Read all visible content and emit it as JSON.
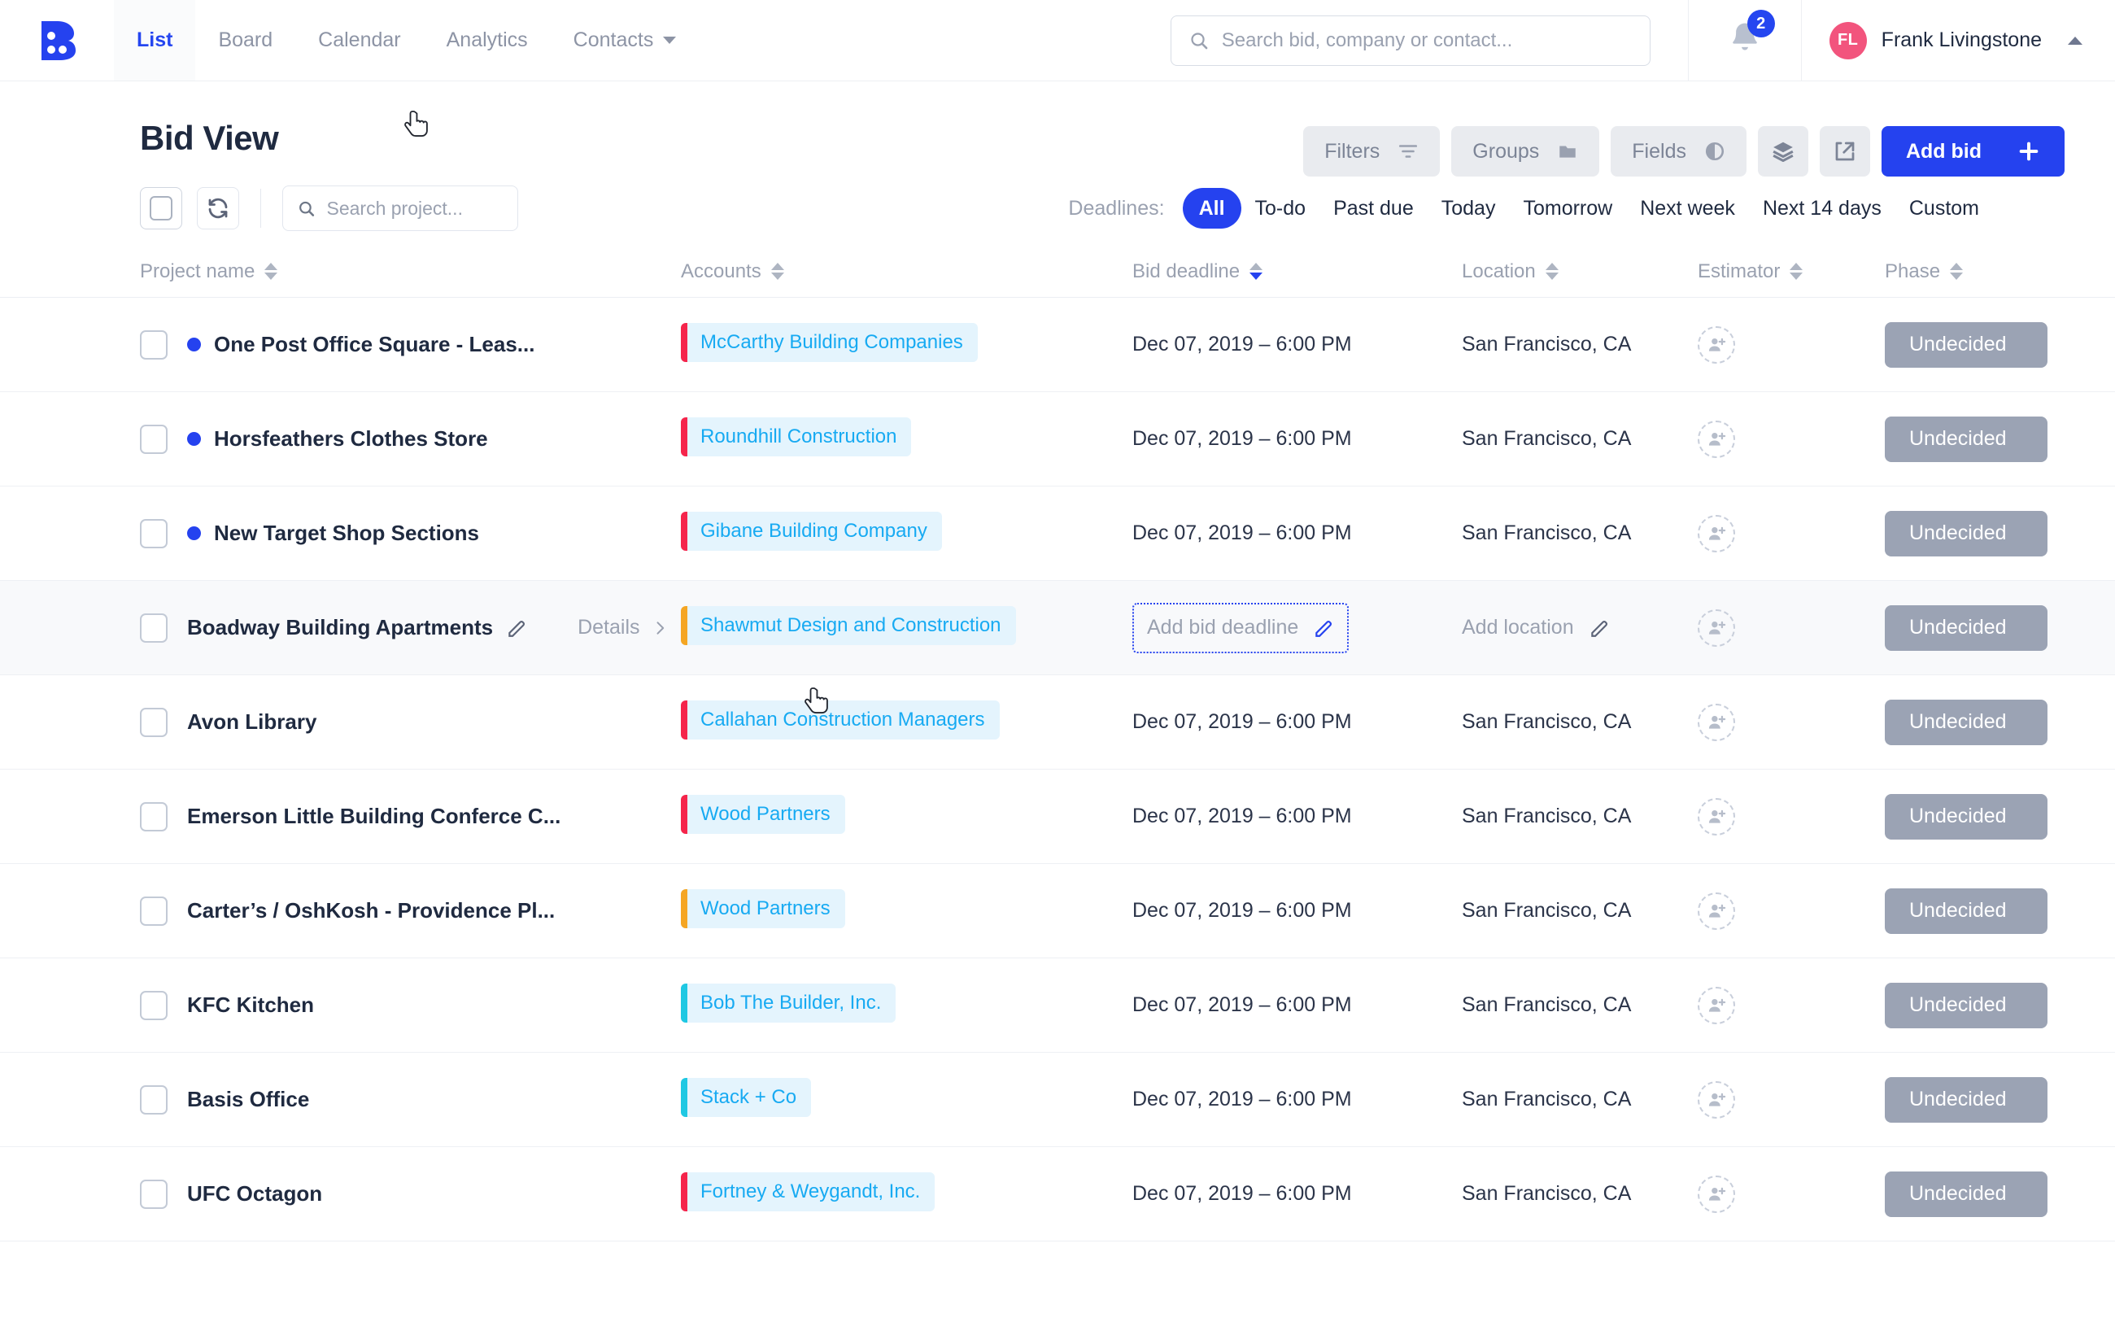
{
  "brand": {
    "accent": "#2542ef",
    "tag_text": "#17aaf2",
    "tag_bg": "#e4f4fd",
    "avatar_bg": "#f2547d",
    "phase_bg": "#9ba3b4"
  },
  "topnav": {
    "logo_name": "bid-logo",
    "tabs": [
      {
        "label": "List",
        "active": true
      },
      {
        "label": "Board",
        "active": false
      },
      {
        "label": "Calendar",
        "active": false
      },
      {
        "label": "Analytics",
        "active": false
      },
      {
        "label": "Contacts",
        "active": false,
        "caret": true
      }
    ],
    "search_placeholder": "Search bid, company or contact...",
    "search_value": "",
    "notification_count": "2",
    "user": {
      "initials": "FL",
      "name": "Frank Livingstone"
    }
  },
  "page": {
    "title": "Bid View"
  },
  "toolbar": {
    "filters_label": "Filters",
    "groups_label": "Groups",
    "fields_label": "Fields",
    "add_bid_label": "Add bid"
  },
  "subbar": {
    "project_search_placeholder": "Search project...",
    "project_search_value": ""
  },
  "deadlines": {
    "label": "Deadlines:",
    "options": [
      {
        "label": "All",
        "active": true
      },
      {
        "label": "To-do",
        "active": false
      },
      {
        "label": "Past due",
        "active": false
      },
      {
        "label": "Today",
        "active": false
      },
      {
        "label": "Tomorrow",
        "active": false
      },
      {
        "label": "Next week",
        "active": false
      },
      {
        "label": "Next 14 days",
        "active": false
      },
      {
        "label": "Custom",
        "active": false
      }
    ]
  },
  "table": {
    "columns": [
      {
        "label": "Project name",
        "sorted": false
      },
      {
        "label": "Accounts",
        "sorted": false
      },
      {
        "label": "Bid deadline",
        "sorted": true
      },
      {
        "label": "Location",
        "sorted": false
      },
      {
        "label": "Estimator",
        "sorted": false
      },
      {
        "label": "Phase",
        "sorted": false
      }
    ],
    "rows": [
      {
        "name": "One Post Office Square - Leas...",
        "unread": true,
        "highlight": false,
        "account": "McCarthy Building Companies",
        "account_color": "#f5254b",
        "deadline": "Dec 07, 2019 – 6:00 PM",
        "location": "San Francisco, CA",
        "phase": "Undecided"
      },
      {
        "name": "Horsfeathers Clothes Store",
        "unread": true,
        "highlight": false,
        "account": "Roundhill Construction",
        "account_color": "#f5254b",
        "deadline": "Dec 07, 2019 – 6:00 PM",
        "location": "San Francisco, CA",
        "phase": "Undecided"
      },
      {
        "name": "New Target Shop Sections",
        "unread": true,
        "highlight": false,
        "account": "Gibane Building Company",
        "account_color": "#f5254b",
        "deadline": "Dec 07, 2019 – 6:00 PM",
        "location": "San Francisco, CA",
        "phase": "Undecided"
      },
      {
        "name": "Boadway Building Apartments",
        "unread": false,
        "highlight": true,
        "details_label": "Details",
        "account": "Shawmut Design and Construction",
        "account_color": "#f5a623",
        "deadline": "",
        "deadline_placeholder": "Add bid deadline",
        "location": "",
        "location_placeholder": "Add location",
        "phase": "Undecided"
      },
      {
        "name": "Avon Library",
        "unread": false,
        "highlight": false,
        "account": "Callahan Construction Managers",
        "account_color": "#f5254b",
        "deadline": "Dec 07, 2019 – 6:00 PM",
        "location": "San Francisco, CA",
        "phase": "Undecided"
      },
      {
        "name": "Emerson Little Building Conferce C...",
        "unread": false,
        "highlight": false,
        "account": "Wood Partners",
        "account_color": "#f5254b",
        "deadline": "Dec 07, 2019 – 6:00 PM",
        "location": "San Francisco, CA",
        "phase": "Undecided"
      },
      {
        "name": "Carter’s / OshKosh - Providence Pl...",
        "unread": false,
        "highlight": false,
        "account": "Wood Partners",
        "account_color": "#f5a623",
        "deadline": "Dec 07, 2019 – 6:00 PM",
        "location": "San Francisco, CA",
        "phase": "Undecided"
      },
      {
        "name": "KFC Kitchen",
        "unread": false,
        "highlight": false,
        "account": "Bob The Builder, Inc.",
        "account_color": "#1fc8e3",
        "deadline": "Dec 07, 2019 – 6:00 PM",
        "location": "San Francisco, CA",
        "phase": "Undecided"
      },
      {
        "name": "Basis Office",
        "unread": false,
        "highlight": false,
        "account": "Stack + Co",
        "account_color": "#1fc8e3",
        "deadline": "Dec 07, 2019 – 6:00 PM",
        "location": "San Francisco, CA",
        "phase": "Undecided"
      },
      {
        "name": "UFC Octagon",
        "unread": false,
        "highlight": false,
        "account": "Fortney & Weygandt, Inc.",
        "account_color": "#f5254b",
        "deadline": "Dec 07, 2019 – 6:00 PM",
        "location": "San Francisco, CA",
        "phase": "Undecided"
      }
    ]
  }
}
